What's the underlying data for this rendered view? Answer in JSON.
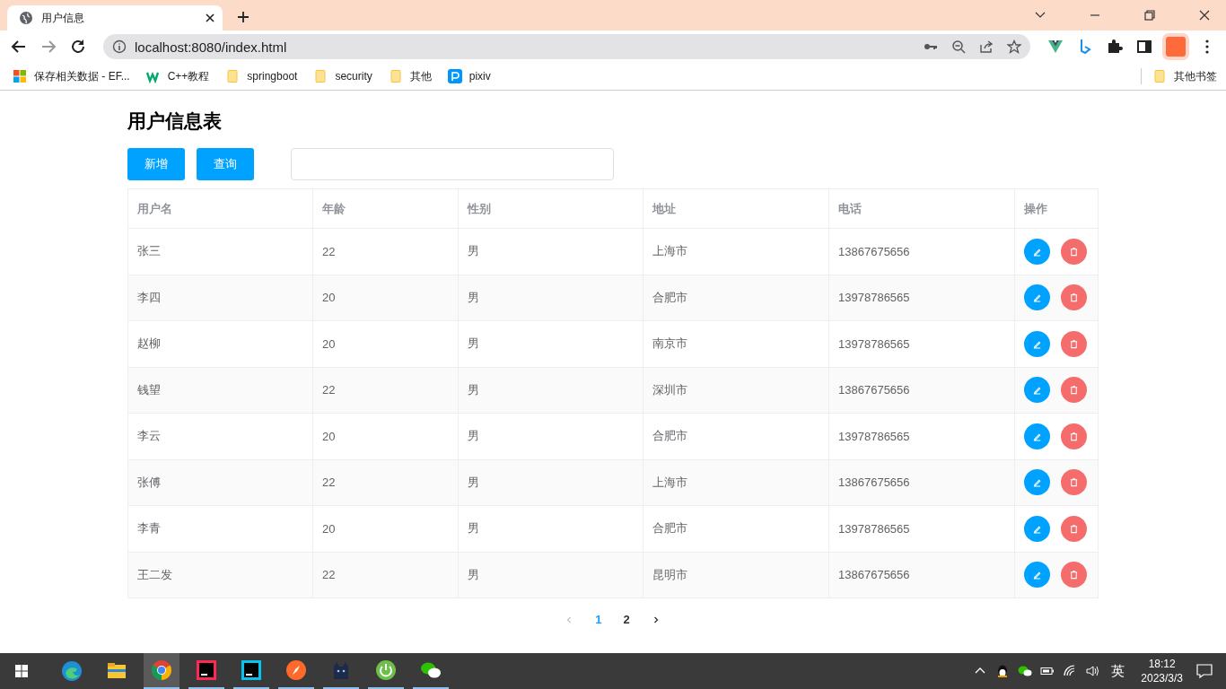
{
  "browser": {
    "tab": {
      "title": "用户信息"
    },
    "url": "localhost:8080/index.html",
    "bookmarks": [
      {
        "label": "保存相关数据 - EF...",
        "kind": "windows"
      },
      {
        "label": "C++教程",
        "kind": "w3"
      },
      {
        "label": "springboot",
        "kind": "folder"
      },
      {
        "label": "security",
        "kind": "folder"
      },
      {
        "label": "其他",
        "kind": "folder"
      },
      {
        "label": "pixiv",
        "kind": "pixiv"
      }
    ],
    "other_bookmarks": "其他书签"
  },
  "page": {
    "title": "用户信息表",
    "buttons": [
      "新增",
      "查询"
    ],
    "table": {
      "columns": [
        "用户名",
        "年龄",
        "性别",
        "地址",
        "电话",
        "操作"
      ],
      "rows": [
        [
          "张三",
          "22",
          "男",
          "上海市",
          "13867675656"
        ],
        [
          "李四",
          "20",
          "男",
          "合肥市",
          "13978786565"
        ],
        [
          "赵柳",
          "20",
          "男",
          "南京市",
          "13978786565"
        ],
        [
          "钱望",
          "22",
          "男",
          "深圳市",
          "13867675656"
        ],
        [
          "李云",
          "20",
          "男",
          "合肥市",
          "13978786565"
        ],
        [
          "张傅",
          "22",
          "男",
          "上海市",
          "13867675656"
        ],
        [
          "李青",
          "20",
          "男",
          "合肥市",
          "13978786565"
        ],
        [
          "王二发",
          "22",
          "男",
          "昆明市",
          "13867675656"
        ]
      ]
    },
    "pagination": {
      "prev_disabled": true,
      "next_disabled": false,
      "pages": [
        {
          "label": "1",
          "selected": true
        },
        {
          "label": "2",
          "selected": false
        }
      ]
    }
  },
  "taskbar": {
    "apps": [
      {
        "kind": "edge",
        "running": false,
        "selected": false
      },
      {
        "kind": "explorer",
        "running": false,
        "selected": false
      },
      {
        "kind": "chrome",
        "running": true,
        "selected": true
      },
      {
        "kind": "intellij",
        "running": true,
        "selected": false
      },
      {
        "kind": "webstorm",
        "running": true,
        "selected": false
      },
      {
        "kind": "compass",
        "running": true,
        "selected": false
      },
      {
        "kind": "cat",
        "running": true,
        "selected": false
      },
      {
        "kind": "power",
        "running": true,
        "selected": false
      },
      {
        "kind": "wechat",
        "running": true,
        "selected": false
      }
    ],
    "ime": "英",
    "time": "18:12",
    "date": "2023/3/3"
  }
}
